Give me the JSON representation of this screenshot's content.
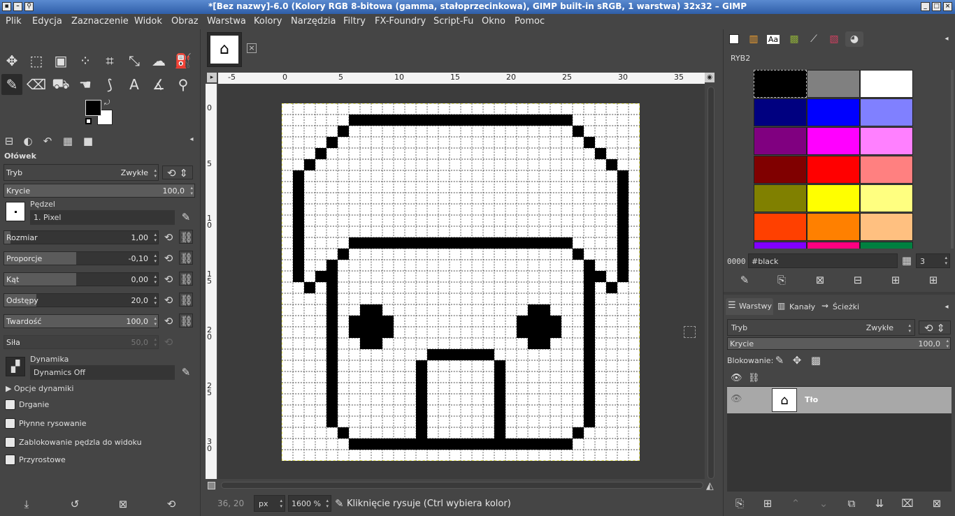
{
  "window": {
    "title": "*[Bez nazwy]-6.0 (Kolory RGB 8-bitowa (gamma, stałoprzecinkowa), GIMP built-in sRGB, 1 warstwa) 32x32 – GIMP"
  },
  "menu": [
    "Plik",
    "Edycja",
    "Zaznaczenie",
    "Widok",
    "Obraz",
    "Warstwa",
    "Kolory",
    "Narzędzia",
    "Filtry",
    "FX-Foundry",
    "Script-Fu",
    "Okno",
    "Pomoc"
  ],
  "tool_options": {
    "tool_name": "Ołówek",
    "mode_label": "Tryb",
    "mode_value": "Zwykłe",
    "opacity_label": "Krycie",
    "opacity_value": "100,0",
    "brush_label": "Pędzel",
    "brush_value": "1. Pixel",
    "size_label": "Rozmiar",
    "size_value": "1,00",
    "aspect_label": "Proporcje",
    "aspect_value": "-0,10",
    "angle_label": "Kąt",
    "angle_value": "0,00",
    "spacing_label": "Odstępy",
    "spacing_value": "20,0",
    "hardness_label": "Twardość",
    "hardness_value": "100,0",
    "force_label": "Siła",
    "force_value": "50,0",
    "dynamics_label": "Dynamika",
    "dynamics_value": "Dynamics Off",
    "dynamics_options": "Opcje dynamiki",
    "jitter": "Drganie",
    "smooth": "Płynne rysowanie",
    "lock_brush": "Zablokowanie pędzla do widoku",
    "incremental": "Przyrostowe"
  },
  "ruler": {
    "h": [
      "-5",
      "0",
      "5",
      "10",
      "15",
      "20",
      "25",
      "30",
      "35"
    ],
    "v": [
      "0",
      "5",
      "10",
      "15",
      "20",
      "25",
      "30"
    ]
  },
  "status": {
    "coords": "36, 20",
    "unit": "px",
    "zoom": "1600 %",
    "message": "Kliknięcie rysuje (Ctrl wybiera kolor)"
  },
  "palette": {
    "name": "RYB2",
    "entry_index": "0000",
    "entry_name": "#black",
    "columns": "3",
    "colors": [
      "#000000",
      "#808080",
      "#ffffff",
      "#000080",
      "#0000ff",
      "#8080ff",
      "#800080",
      "#ff00ff",
      "#ff80ff",
      "#800000",
      "#ff0000",
      "#ff8080",
      "#808000",
      "#ffff00",
      "#ffff80",
      "#ff4000",
      "#ff8000",
      "#ffc080",
      "#8000ff",
      "#ff0080",
      "#008040"
    ]
  },
  "layers": {
    "tab_layers": "Warstwy",
    "tab_channels": "Kanały",
    "tab_paths": "Ścieżki",
    "mode_label": "Tryb",
    "mode_value": "Zwykłe",
    "opacity_label": "Krycie",
    "opacity_value": "100,0",
    "lock_label": "Blokowanie:",
    "layer_name": "Tło"
  },
  "colors": {
    "fg": "#000000",
    "bg": "#ffffff",
    "accent": "#2f5ea8"
  }
}
